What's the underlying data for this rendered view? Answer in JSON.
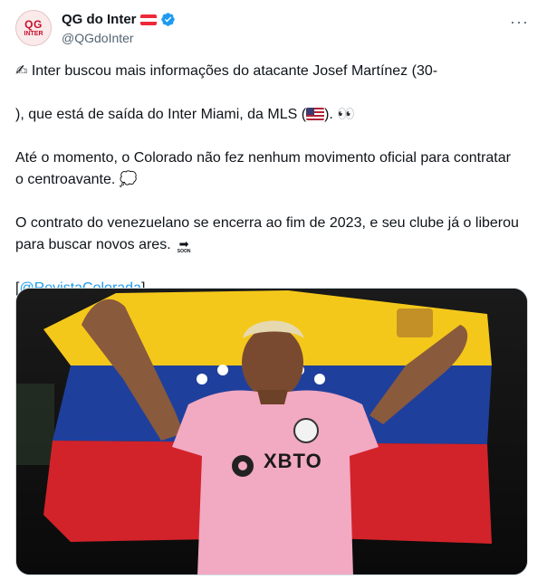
{
  "account": {
    "avatar_text_top": "QG",
    "avatar_text_bottom": "INTER",
    "name": "QG do Inter",
    "handle": "@QGdoInter"
  },
  "tweet": {
    "p1_a": "Inter buscou mais informações do atacante Josef Martínez (30-",
    "p1_b": "),",
    "p1_c": "que está de saída do Inter Miami, da MLS (",
    "p1_d": ").",
    "p1_emoji_writing": "✍",
    "p1_emoji_eyes": "👀",
    "p2": "Até o momento, o Colorado não fez nenhum movimento oficial para contratar o centroavante.",
    "p2_emoji": "💭",
    "p3": "O contrato do venezuelano se encerra ao fim de 2023, e seu clube já o liberou para buscar novos ares.",
    "p3_emoji_arrow": "➡",
    "p3_emoji_text": "SOON",
    "mention_open": "[",
    "mention": "@RevistaColorada",
    "mention_close": "]"
  },
  "media": {
    "jersey_sponsor": "XBTO"
  },
  "colors": {
    "link": "#1d9bf0",
    "verified": "#1d9bf0",
    "jersey_pink": "#f2a9c2",
    "flag_yellow": "#f4c81a",
    "flag_blue": "#1f3f9c",
    "flag_red": "#d2232a"
  },
  "icons": {
    "more": "more-horizontal-icon",
    "verified": "verified-badge-icon"
  }
}
